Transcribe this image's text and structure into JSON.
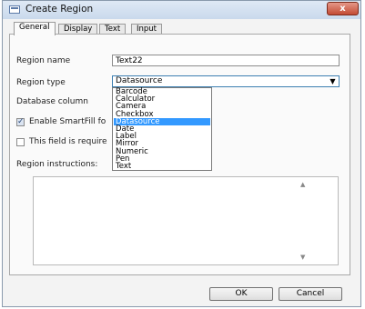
{
  "window": {
    "title": "Create Region",
    "close_label": "x"
  },
  "tabs": [
    {
      "label": "General",
      "active": true
    },
    {
      "label": "Display"
    },
    {
      "label": "Text"
    },
    {
      "label": "Input"
    }
  ],
  "form": {
    "region_name_label": "Region name",
    "region_name_value": "Text22",
    "region_type_label": "Region type",
    "region_type_value": "Datasource",
    "database_column_label": "Database column",
    "smartfill_label": "Enable SmartFill fo",
    "smartfill_checked": true,
    "required_label": "This field is require",
    "required_checked": false,
    "instructions_label": "Region instructions:"
  },
  "dropdown": {
    "options": [
      "Barcode",
      "Calculator",
      "Camera",
      "Checkbox",
      "Datasource",
      "Date",
      "Label",
      "Mirror",
      "Numeric",
      "Pen",
      "Text"
    ],
    "selected": "Datasource"
  },
  "buttons": {
    "ok": "OK",
    "cancel": "Cancel"
  },
  "icons": {
    "app": "window-icon",
    "close": "close-icon",
    "arrow": "chevron-down-icon"
  }
}
